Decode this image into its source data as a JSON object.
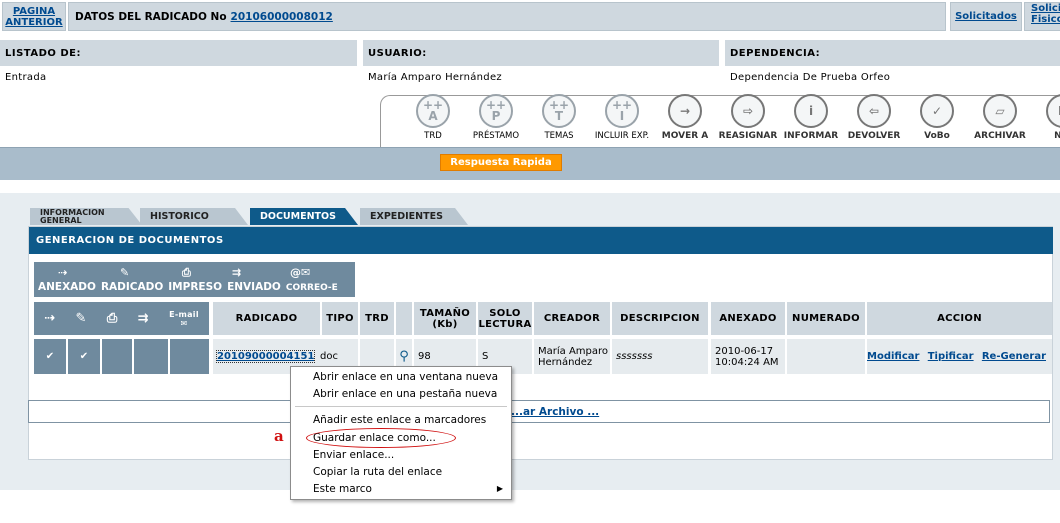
{
  "header": {
    "back_label_1": "PAGINA",
    "back_label_2": "ANTERIOR",
    "title_prefix": "DATOS DEL RADICADO No",
    "radicado": "20106000008012",
    "solicitados": "Solicitados",
    "solic_1": "Solici",
    "solic_2": "Fisico"
  },
  "info": {
    "listado_label": "LISTADO DE:",
    "listado_value": "Entrada",
    "usuario_label": "USUARIO:",
    "usuario_value": "María Amparo Hernández",
    "dependencia_label": "DEPENDENCIA:",
    "dependencia_value": "Dependencia De Prueba Orfeo"
  },
  "tools": [
    {
      "label": "TRD",
      "glyph": "++\nA"
    },
    {
      "label": "PRÉSTAMO",
      "glyph": "++\nP"
    },
    {
      "label": "TEMAS",
      "glyph": "++\nT"
    },
    {
      "label": "INCLUIR EXP.",
      "glyph": "++\nI"
    },
    {
      "label": "MOVER A",
      "glyph": "→"
    },
    {
      "label": "REASIGNAR",
      "glyph": "⇨"
    },
    {
      "label": "INFORMAR",
      "glyph": "i"
    },
    {
      "label": "DEVOLVER",
      "glyph": "⇦"
    },
    {
      "label": "VoBo",
      "glyph": "✓"
    },
    {
      "label": "ARCHIVAR",
      "glyph": "▱"
    },
    {
      "label": "N/R",
      "glyph": "N"
    }
  ],
  "respuesta_rapida": "Respuesta Rapida",
  "tabs": {
    "info_1": "INFORMACION",
    "info_2": "GENERAL",
    "historico": "HISTORICO",
    "documentos": "DOCUMENTOS",
    "expedientes": "EXPEDIENTES"
  },
  "section_title": "GENERACION DE DOCUMENTOS",
  "actions_bar": {
    "anexado": "ANEXADO",
    "radicado": "RADICADO",
    "impreso": "IMPRESO",
    "enviado": "ENVIADO",
    "correo": "CORREO-E",
    "email_icon_text": "E-mail"
  },
  "table": {
    "headers": {
      "radicado": "RADICADO",
      "tipo": "TIPO",
      "trd": "TRD",
      "tamano_1": "TAMAÑO",
      "tamano_2": "(Kb)",
      "solo_1": "SOLO",
      "solo_2": "LECTURA",
      "creador": "CREADOR",
      "descripcion": "DESCRIPCION",
      "anexado": "ANEXADO",
      "numerado": "NUMERADO",
      "accion": "ACCION"
    },
    "row": {
      "radicado": "20109000004151",
      "tipo": "doc",
      "tamano": "98",
      "solo_lectura": "S",
      "creador_1": "María Amparo",
      "creador_2": "Hernández",
      "descripcion": "sssssss",
      "anexado_1": "2010-06-17",
      "anexado_2": "10:04:24 AM",
      "modificar": "Modificar",
      "tipificar": "Tipificar",
      "regenerar": "Re-Generar"
    }
  },
  "upload_link": "...ar Archivo ...",
  "context_menu": {
    "items": [
      "Abrir enlace en una ventana nueva",
      "Abrir enlace en una pestaña nueva",
      "Añadir este enlace a marcadores",
      "Guardar enlace como...",
      "Enviar enlace...",
      "Copiar la ruta del enlace",
      "Este marco"
    ]
  },
  "annotation": "a",
  "colors": {
    "header_gray": "#cfd8df",
    "primary_blue": "#0e5a8a",
    "action_button": "#ff9900",
    "annotation_red": "#d01010"
  }
}
